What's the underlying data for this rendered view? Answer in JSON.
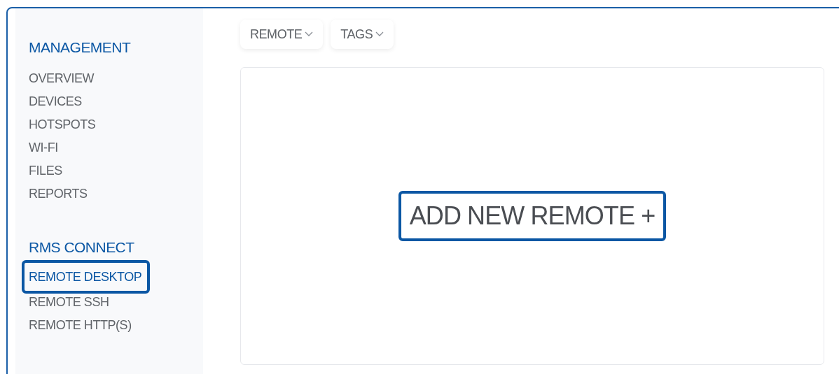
{
  "sidebar": {
    "sections": [
      {
        "title": "MANAGEMENT",
        "items": [
          {
            "label": "OVERVIEW",
            "selected": false,
            "highlighted": false
          },
          {
            "label": "DEVICES",
            "selected": false,
            "highlighted": false
          },
          {
            "label": "HOTSPOTS",
            "selected": false,
            "highlighted": false
          },
          {
            "label": "WI-FI",
            "selected": false,
            "highlighted": false
          },
          {
            "label": "FILES",
            "selected": false,
            "highlighted": false
          },
          {
            "label": "REPORTS",
            "selected": false,
            "highlighted": false
          }
        ]
      },
      {
        "title": "RMS CONNECT",
        "items": [
          {
            "label": "REMOTE DESKTOP",
            "selected": true,
            "highlighted": true
          },
          {
            "label": "REMOTE SSH",
            "selected": false,
            "highlighted": false
          },
          {
            "label": "REMOTE HTTP(S)",
            "selected": false,
            "highlighted": false
          }
        ]
      }
    ]
  },
  "toolbar": {
    "dropdowns": [
      {
        "label": "REMOTE"
      },
      {
        "label": "TAGS"
      }
    ]
  },
  "panel": {
    "add_button": {
      "label": "ADD NEW REMOTE +",
      "highlighted": true
    }
  }
}
